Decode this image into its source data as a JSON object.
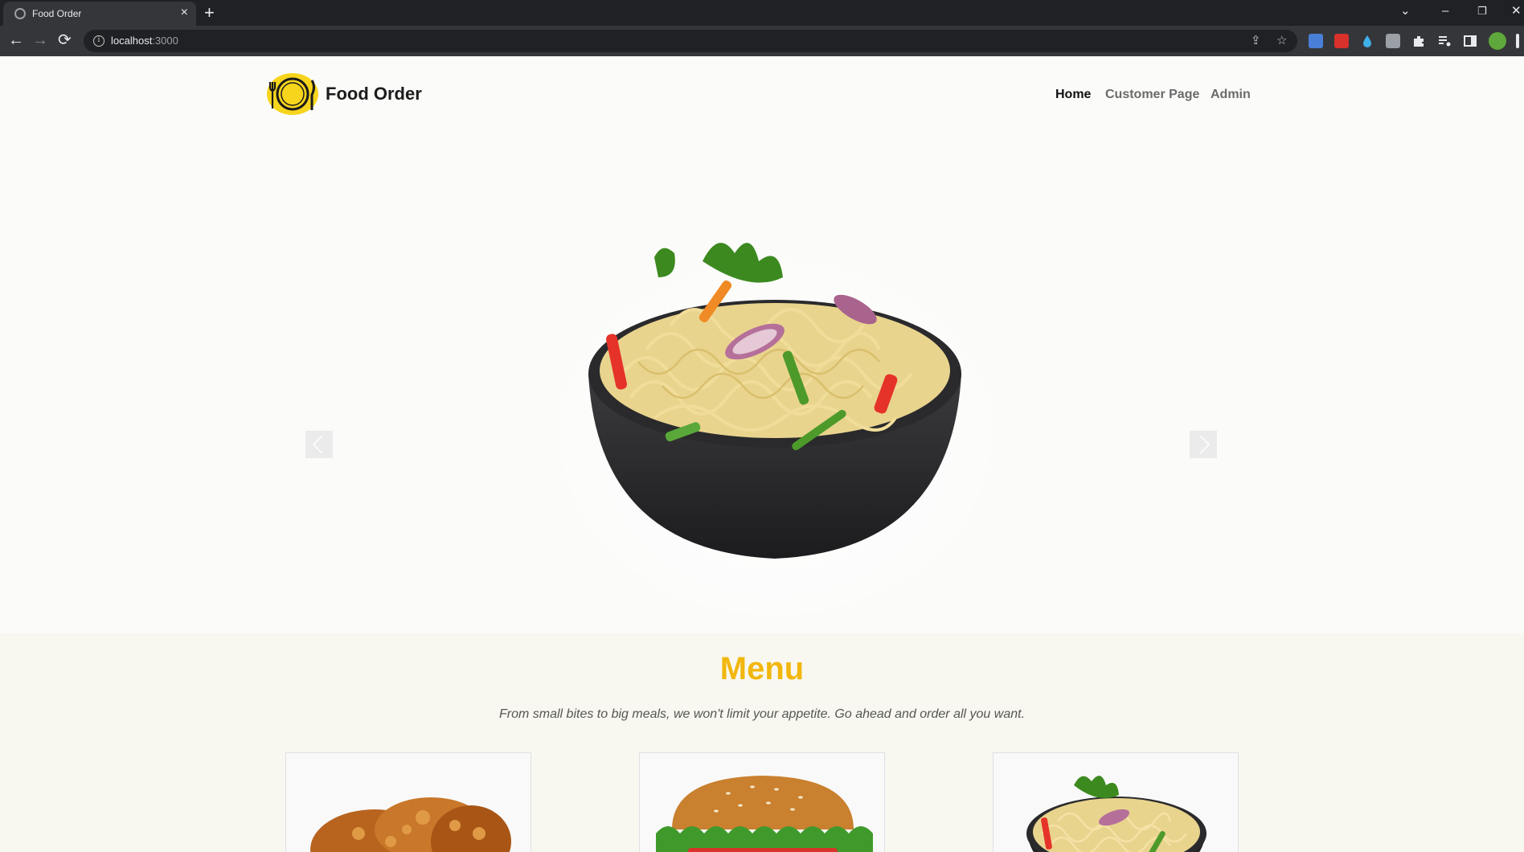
{
  "browser": {
    "tab_title": "Food Order",
    "tab_close": "×",
    "new_tab": "+",
    "url_host": "localhost",
    "url_port": ":3000",
    "controls": {
      "tab_search": "⌄",
      "minimize": "–",
      "restore": "❐",
      "close": "✕"
    },
    "nav": {
      "back": "←",
      "forward": "→",
      "reload": "⟳"
    },
    "omnibox_icons": {
      "share": "⇪",
      "bookmark": "☆"
    }
  },
  "header": {
    "brand": "Food Order",
    "nav": [
      {
        "label": "Home",
        "active": true
      },
      {
        "label": "Customer Page",
        "active": false
      },
      {
        "label": "Admin",
        "active": false
      }
    ]
  },
  "carousel": {
    "prev_label": "‹",
    "next_label": "›",
    "slide_count": 3,
    "active_slide": 3,
    "current_slide_image": "noodles-bowl-image"
  },
  "menu": {
    "title": "Menu",
    "subtitle": "From small bites to big meals, we won't limit your appetite. Go ahead and order all you want.",
    "cards": [
      {
        "image": "fried-chicken-image"
      },
      {
        "image": "burger-image"
      },
      {
        "image": "noodles-bowl-image"
      }
    ]
  },
  "colors": {
    "accent": "#f2b70d",
    "logo_yellow": "#f7d51d",
    "background": "#fbfbfa",
    "menu_background": "#f8f8f0"
  }
}
